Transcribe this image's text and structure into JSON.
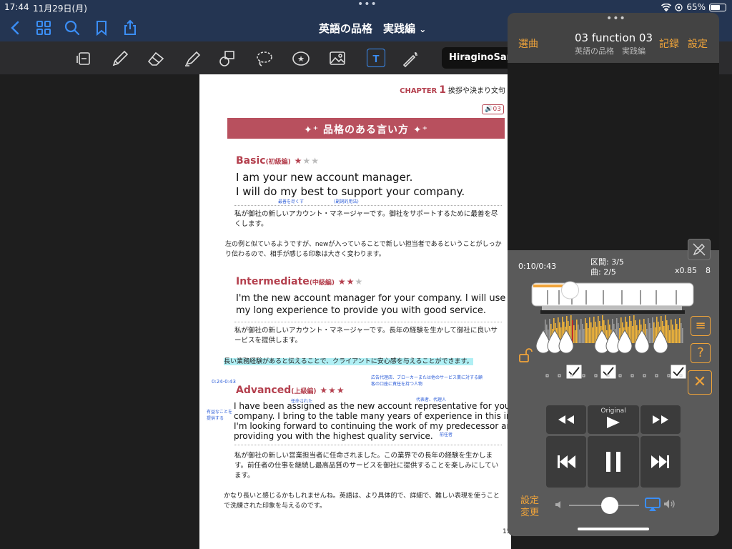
{
  "status": {
    "time": "17:44",
    "date": "11月29日(月)",
    "battery": "65%",
    "battery_level": 0.65
  },
  "nav": {
    "title": "英語の品格　実践編",
    "title_chevron": "⌄"
  },
  "toolbar": {
    "font_name": "HiraginoSans-"
  },
  "page": {
    "chapter_label": "CHAPTER",
    "chapter_num": "1",
    "chapter_title": "挨拶や決まり文句",
    "track": "03",
    "banner": "品格のある言い方",
    "basic": {
      "title": "Basic",
      "sub": "(初級編)",
      "stars_on": "★",
      "stars_off": "★★",
      "line1": "I am your new account manager.",
      "line2": "I will do my best to support your company.",
      "ann1": "最善を尽くす",
      "ann2": "(副詞的用法)",
      "jp": "私が御社の新しいアカウント・マネージャーです。御社をサポートするために最善を尽くします。"
    },
    "note1": "左の例と似ているようですが、newが入っていることで新しい担当者であるということがしっかり伝わるので、相手が感じる印象は大きく変わります。",
    "intermediate": {
      "title": "Intermediate",
      "sub": "(中級編)",
      "stars_on": "★★",
      "stars_off": "★",
      "line1": "I'm the new account manager for your company. I will use",
      "line2": "my long experience to provide you with good service.",
      "jp": "私が御社の新しいアカウント・マネージャーです。長年の経験を生かして御社に良いサービスを提供します。"
    },
    "note2": "長い業務経験があると伝えることで、クライアントに安心感を与えることができます。",
    "time_note": "0:24-0:43",
    "advanced": {
      "title": "Advanced",
      "sub": "(上級編)",
      "stars_on": "★★★",
      "ann_top": "広告代理店、ブローカーまたは他のサービス業に対する顧客の口座に責任を持つ人物",
      "ann_appointed": "任命された",
      "ann_rep": "代表者、代理人",
      "ann_side": "有益なことを提供する",
      "ann_pred": "前任者",
      "line1": "I have been assigned as the new account representative for your",
      "line2": "company. I bring to the table many years of experience in this industry.",
      "line3": "I'm looking forward to continuing the work of my predecessor and",
      "line4": "providing you with the highest quality service.",
      "jp": "私が御社の新しい営業担当者に任命されました。この業界での長年の経験を生かします。前任者の仕事を継続し最高品質のサービスを御社に提供することを楽しみにしています。"
    },
    "note3": "かなり長いと感じるかもしれませんね。英語は、より具体的で、詳細で、難しい表現を使うことで洗練された印象を与えるのです。",
    "page_num": "15"
  },
  "player": {
    "select_song": "選曲",
    "track_title": "03 function 03",
    "album": "英語の品格　実践編",
    "record": "記録",
    "settings": "設定",
    "time": "0:10/0:43",
    "section": "区間: 3/5",
    "song": "曲: 2/5",
    "speed": "x0.85",
    "speed_num": "8",
    "progress": 0.23,
    "original_label": "Original",
    "settings_change": "設定\n変更",
    "volume": 0.58,
    "accent": "#f0a43a"
  }
}
